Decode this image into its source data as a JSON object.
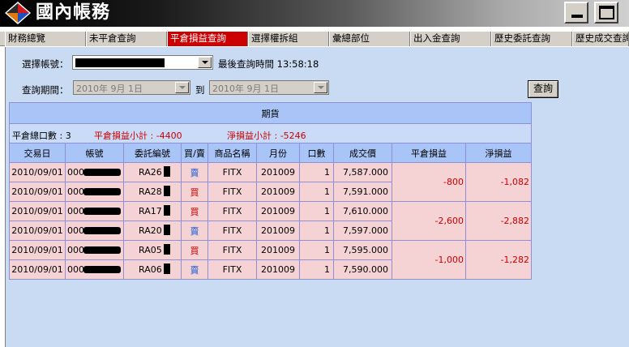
{
  "window": {
    "title": "國內帳務",
    "colors": {
      "titlebar_start": "#000000",
      "titlebar_end": "#d0d0d0",
      "active_tab": "#cc0000",
      "content_bg": "#c9daf3",
      "row_bg": "#f5d3d5",
      "header_bg": "#a9c4f7"
    }
  },
  "tabs": [
    {
      "label": "財務總覽",
      "active": false
    },
    {
      "label": "未平倉查詢",
      "active": false
    },
    {
      "label": "平倉損益查詢",
      "active": true
    },
    {
      "label": "選擇權拆組",
      "active": false
    },
    {
      "label": "彙總部位",
      "active": false
    },
    {
      "label": "出入金查詢",
      "active": false
    },
    {
      "label": "歷史委託查詢",
      "active": false
    },
    {
      "label": "歷史成交查詢",
      "active": false
    }
  ],
  "filters": {
    "account_label": "選擇帳號：",
    "last_query_label": "最後查詢時間",
    "last_query_time": "13:58:18",
    "period_label": "查詢期間：",
    "start_date": "2010年  9月  1日",
    "to_label": "到",
    "end_date": "2010年  9月  1日",
    "query_button": "查詢"
  },
  "table": {
    "section_title": "期貨",
    "summary": {
      "closed_lots_label": "平倉總口數 : 3",
      "pnl_subtotal_label": "平倉損益小計 : -4400",
      "net_pnl_subtotal_label": "淨損益小計 : -5246"
    },
    "columns": [
      "交易日",
      "帳號",
      "委託編號",
      "買/賣",
      "商品名稱",
      "月份",
      "口數",
      "成交價",
      "平倉損益",
      "淨損益"
    ],
    "rows": [
      {
        "date": "2010/09/01",
        "account_prefix": "000-",
        "order_prefix": "RA26",
        "side": "賣",
        "side_color": "blue",
        "product": "FITX",
        "month": "201009",
        "qty": "1",
        "price": "7,587.000"
      },
      {
        "date": "2010/09/01",
        "account_prefix": "000-",
        "order_prefix": "RA28",
        "side": "買",
        "side_color": "red",
        "product": "FITX",
        "month": "201009",
        "qty": "1",
        "price": "7,591.000"
      },
      {
        "date": "2010/09/01",
        "account_prefix": "000-",
        "order_prefix": "RA17",
        "side": "買",
        "side_color": "red",
        "product": "FITX",
        "month": "201009",
        "qty": "1",
        "price": "7,610.000"
      },
      {
        "date": "2010/09/01",
        "account_prefix": "000-",
        "order_prefix": "RA20",
        "side": "賣",
        "side_color": "blue",
        "product": "FITX",
        "month": "201009",
        "qty": "1",
        "price": "7,597.000"
      },
      {
        "date": "2010/09/01",
        "account_prefix": "000-",
        "order_prefix": "RA05",
        "side": "買",
        "side_color": "red",
        "product": "FITX",
        "month": "201009",
        "qty": "1",
        "price": "7,595.000"
      },
      {
        "date": "2010/09/01",
        "account_prefix": "000-",
        "order_prefix": "RA06",
        "side": "賣",
        "side_color": "blue",
        "product": "FITX",
        "month": "201009",
        "qty": "1",
        "price": "7,590.000"
      }
    ],
    "pairs": [
      {
        "close_pnl": "-800",
        "net_pnl": "-1,082"
      },
      {
        "close_pnl": "-2,600",
        "net_pnl": "-2,882"
      },
      {
        "close_pnl": "-1,000",
        "net_pnl": "-1,282"
      }
    ]
  }
}
